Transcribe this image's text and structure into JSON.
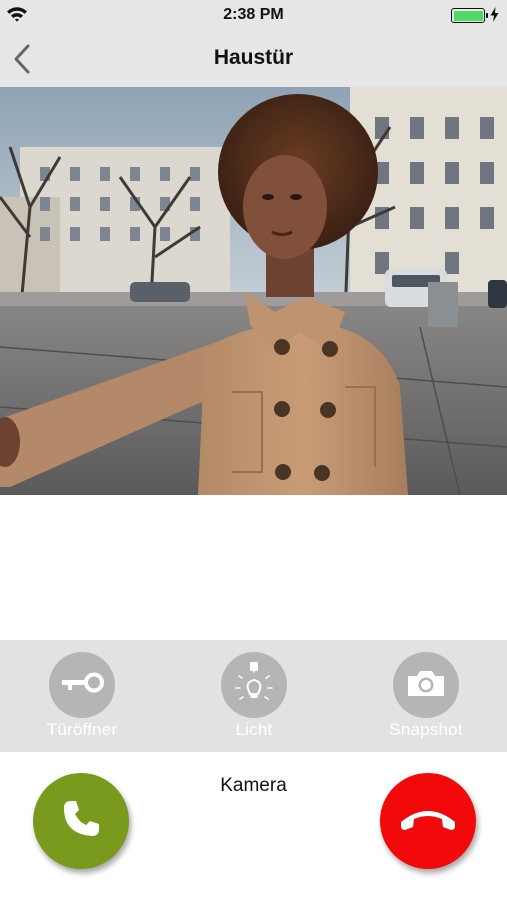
{
  "status_bar": {
    "time": "2:38 PM",
    "battery_level": 1.0
  },
  "nav": {
    "title": "Haustür",
    "back_icon": "chevron-left-icon"
  },
  "camera": {
    "description_icon": "video-feed"
  },
  "actions": [
    {
      "label": "Türöffner",
      "icon": "key-icon"
    },
    {
      "label": "Licht",
      "icon": "light-bulb-icon"
    },
    {
      "label": "Snapshot",
      "icon": "camera-icon"
    }
  ],
  "mode_label": "Kamera",
  "call": {
    "accept_icon": "phone-icon",
    "decline_icon": "hang-up-icon"
  },
  "colors": {
    "accept": "#7a9a1d",
    "decline": "#f20a0a",
    "bar_bg": "#e2e2e2",
    "action_circle": "#b5b5b5"
  }
}
